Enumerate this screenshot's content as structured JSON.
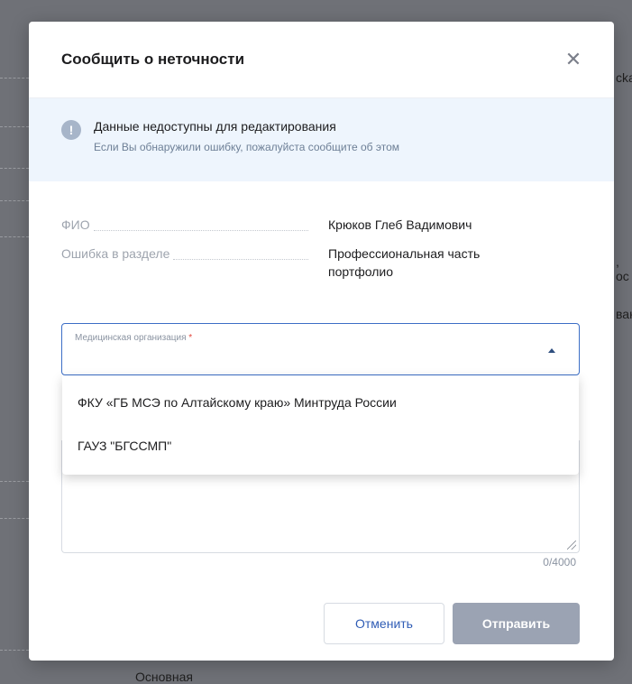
{
  "modal": {
    "title": "Сообщить о неточности",
    "close_icon": "close-icon"
  },
  "info": {
    "icon": "exclamation-icon",
    "title": "Данные недоступны для редактирования",
    "subtitle": "Если Вы обнаружили ошибку, пожалуйста сообщите об этом"
  },
  "fields": [
    {
      "label": "ФИО",
      "value": "Крюков Глеб Вадимович"
    },
    {
      "label": "Ошибка в разделе",
      "value": "Профессиональная часть портфолио"
    }
  ],
  "select": {
    "label": "Медицинская организация",
    "required_mark": "*",
    "value": "",
    "expanded": true,
    "options": [
      "ФКУ «ГБ МСЭ по Алтайскому краю» Минтруда России",
      "ГАУЗ \"БГССМП\""
    ]
  },
  "textarea": {
    "value": "",
    "counter": "0/4000"
  },
  "buttons": {
    "cancel": "Отменить",
    "send": "Отправить"
  },
  "background": {
    "fragments": [
      "cka",
      ", oc",
      "ван",
      "Основная"
    ]
  },
  "colors": {
    "primary": "#3c6ec6",
    "info_bg": "#eef5fd",
    "disabled_button": "#9ba3b3"
  }
}
